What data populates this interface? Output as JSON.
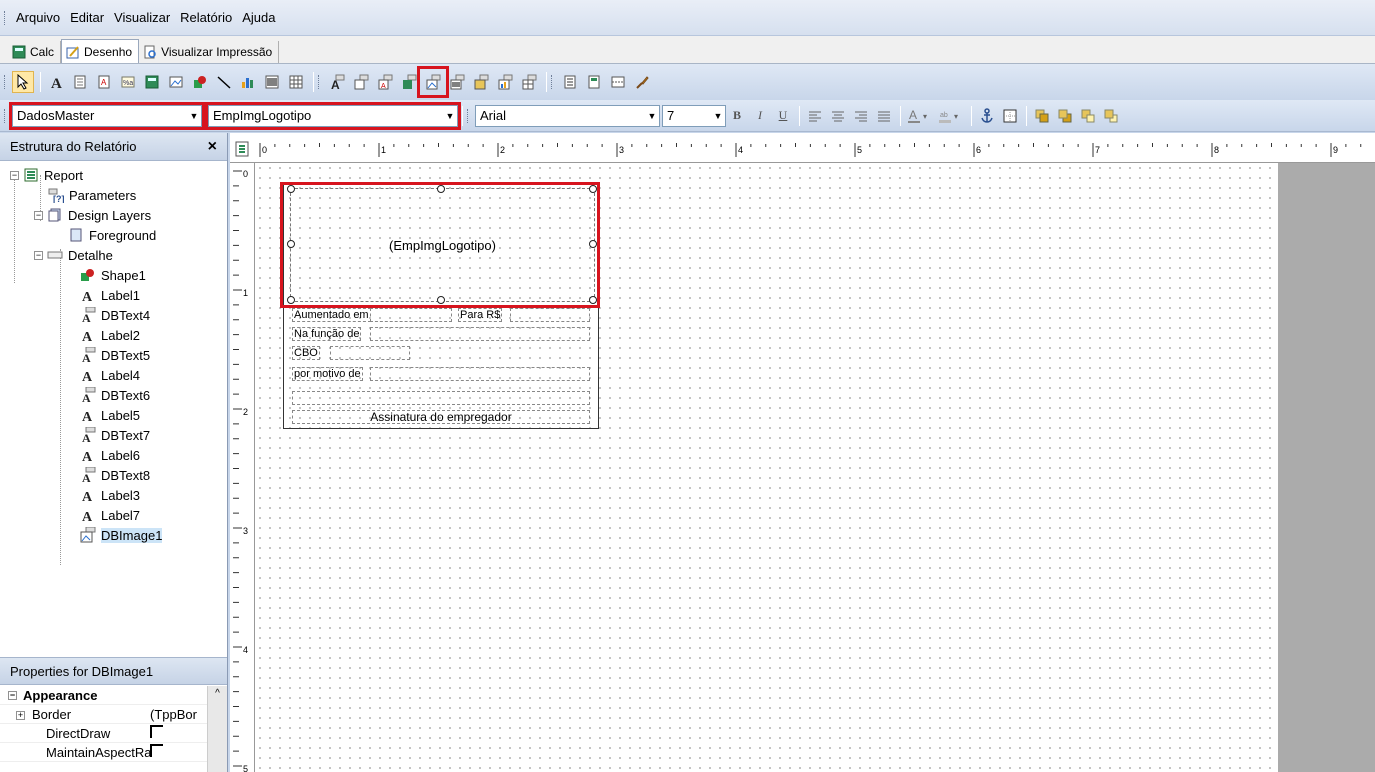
{
  "menu": [
    "Arquivo",
    "Editar",
    "Visualizar",
    "Relatório",
    "Ajuda"
  ],
  "tabs": [
    {
      "label": "Calc",
      "icon": "calc-icon"
    },
    {
      "label": "Desenho",
      "icon": "draw-icon",
      "active": true
    },
    {
      "label": "Visualizar Impressão",
      "icon": "print-preview-icon"
    }
  ],
  "toolbar2": {
    "datapipeline": "DadosMaster",
    "datafield": "EmpImgLogotipo",
    "font": "Arial",
    "size": "7",
    "bold": "B",
    "italic": "I",
    "underline": "U"
  },
  "tree_panel": {
    "title": "Estrutura do Relatório",
    "close": "×",
    "nodes": [
      "Report",
      "Parameters",
      "Design Layers",
      "Foreground",
      "Detalhe",
      "Shape1",
      "Label1",
      "DBText4",
      "Label2",
      "DBText5",
      "Label4",
      "DBText6",
      "Label5",
      "DBText7",
      "Label6",
      "DBText8",
      "Label3",
      "Label7",
      "DBImage1"
    ]
  },
  "properties": {
    "title": "Properties for DBImage1",
    "category": "Appearance",
    "rows": [
      {
        "name": "Border",
        "value": "(TppBor"
      },
      {
        "name": "DirectDraw",
        "value": ""
      },
      {
        "name": "MaintainAspectRa",
        "value": ""
      }
    ]
  },
  "ruler": {
    "h_numbers": [
      "0",
      "1",
      "2",
      "3",
      "4",
      "5",
      "6",
      "7",
      "8",
      "9"
    ],
    "v_numbers": [
      "0",
      "1",
      "2",
      "3",
      "4",
      "5"
    ]
  },
  "report": {
    "image_label": "(EmpImgLogotipo)",
    "labels": {
      "aumentado": "Aumentado em",
      "para": "Para R$",
      "funcao": "Na função de",
      "cbo": "CBO",
      "motivo": "por motivo de",
      "assinatura": "Assinatura do empregador"
    }
  },
  "colors": {
    "highlight": "#d7141e",
    "toolbar_bg": "#c8d6ea"
  }
}
